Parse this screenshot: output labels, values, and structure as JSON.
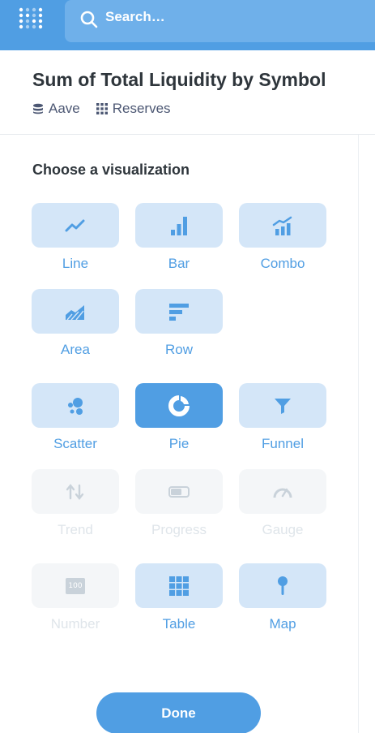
{
  "search": {
    "placeholder": "Search…"
  },
  "header": {
    "title": "Sum of Total Liquidity by Symbol",
    "database": "Aave",
    "table": "Reserves"
  },
  "picker": {
    "title": "Choose a visualization",
    "items": [
      {
        "label": "Line",
        "icon": "line-chart-icon",
        "state": "enabled"
      },
      {
        "label": "Bar",
        "icon": "bar-chart-icon",
        "state": "enabled"
      },
      {
        "label": "Combo",
        "icon": "combo-chart-icon",
        "state": "enabled"
      },
      {
        "label": "Area",
        "icon": "area-chart-icon",
        "state": "enabled"
      },
      {
        "label": "Row",
        "icon": "row-chart-icon",
        "state": "enabled"
      },
      {
        "label": "Scatter",
        "icon": "scatter-icon",
        "state": "enabled"
      },
      {
        "label": "Pie",
        "icon": "pie-icon",
        "state": "selected"
      },
      {
        "label": "Funnel",
        "icon": "funnel-icon",
        "state": "enabled"
      },
      {
        "label": "Trend",
        "icon": "trend-icon",
        "state": "disabled"
      },
      {
        "label": "Progress",
        "icon": "progress-icon",
        "state": "disabled"
      },
      {
        "label": "Gauge",
        "icon": "gauge-icon",
        "state": "disabled"
      },
      {
        "label": "Number",
        "icon": "number-icon",
        "state": "disabled",
        "icon_text": "100"
      },
      {
        "label": "Table",
        "icon": "table-icon",
        "state": "enabled"
      },
      {
        "label": "Map",
        "icon": "map-pin-icon",
        "state": "enabled"
      }
    ]
  },
  "done_label": "Done",
  "colors": {
    "brand": "#509ee3",
    "tile": "#d4e6f8",
    "disabled_tile": "#f4f6f8",
    "text_dark": "#2e353b"
  }
}
